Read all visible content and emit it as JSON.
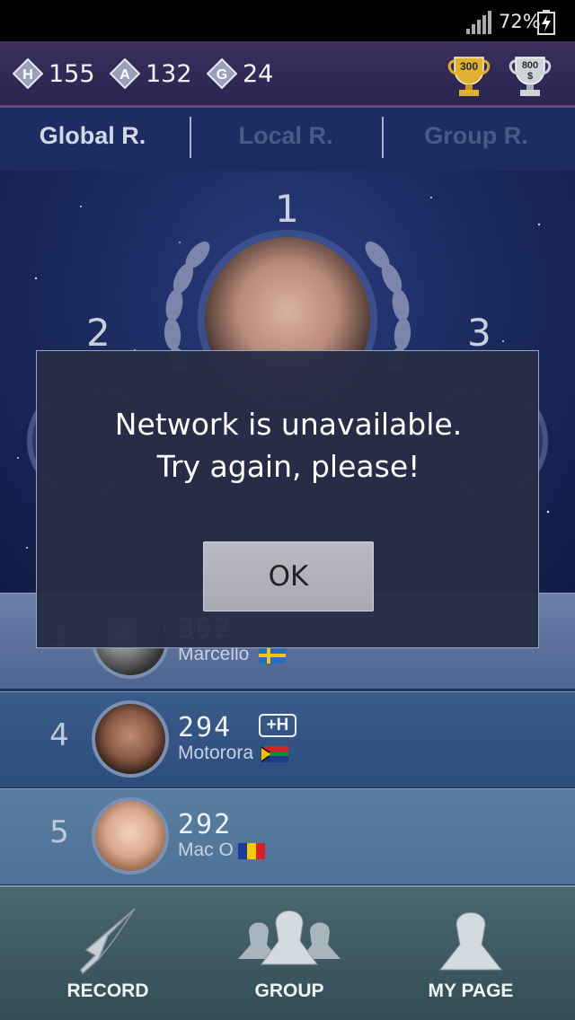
{
  "status_bar": {
    "battery": "72%"
  },
  "currency": [
    {
      "letter": "H",
      "value": "155"
    },
    {
      "letter": "A",
      "value": "132"
    },
    {
      "letter": "G",
      "value": "24"
    }
  ],
  "trophies": [
    {
      "label": "300",
      "color": "#e0b030"
    },
    {
      "label": "800\n$",
      "color": "#cfd3da"
    }
  ],
  "tabs": [
    {
      "label": "Global R.",
      "active": true
    },
    {
      "label": "Local R.",
      "active": false
    },
    {
      "label": "Group R.",
      "active": false
    }
  ],
  "podium": {
    "first": "1",
    "second": "2",
    "third": "3"
  },
  "rows": [
    {
      "rank": "3",
      "score": "302",
      "name": "Marcello",
      "flag": "sweden"
    },
    {
      "rank": "4",
      "score": "294",
      "name": "Motorora",
      "flag": "south-africa",
      "badge": "+H"
    },
    {
      "rank": "5",
      "score": "292",
      "name": "Mac O",
      "flag": "romania"
    }
  ],
  "nav": [
    {
      "label": "RECORD",
      "icon": "quill-icon"
    },
    {
      "label": "GROUP",
      "icon": "group-icon"
    },
    {
      "label": "MY PAGE",
      "icon": "person-icon"
    }
  ],
  "dialog": {
    "line1": "Network is unavailable.",
    "line2": "Try again, please!",
    "ok": "OK"
  },
  "colors": {
    "accent_gold": "#e0b030",
    "dialog_bg": "#282d46"
  }
}
